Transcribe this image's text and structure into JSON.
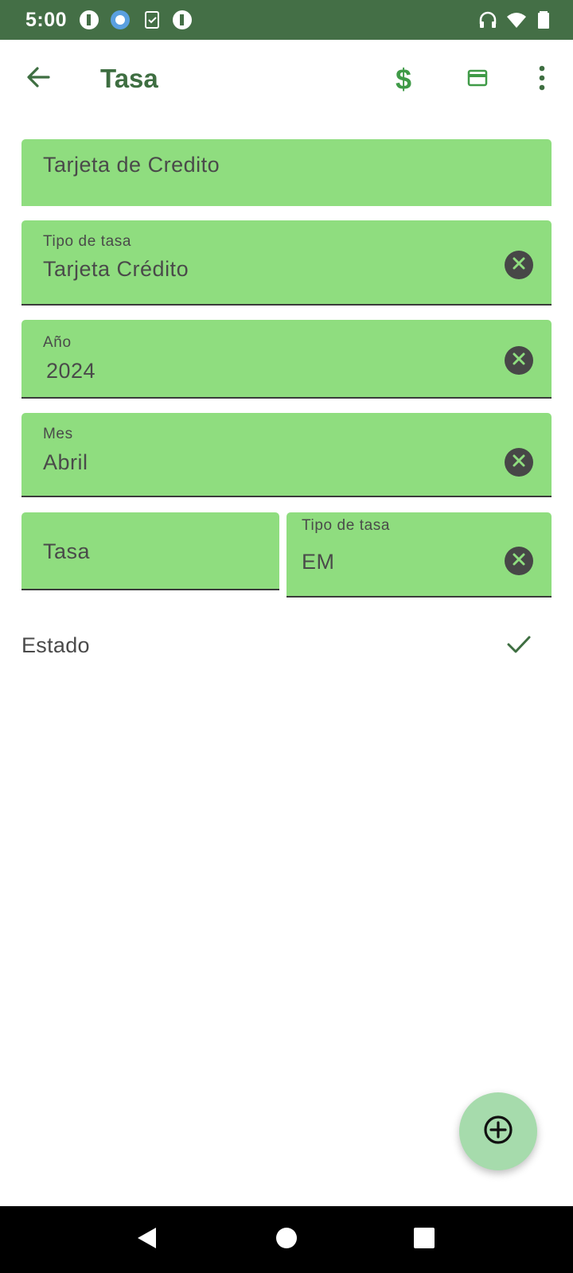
{
  "status_bar": {
    "time": "5:00",
    "left_icons": [
      "notification-app-icon",
      "notification-globe-icon",
      "notification-clipboard-icon",
      "notification-app-icon"
    ],
    "right_icons": [
      "headphones-icon",
      "wifi-icon",
      "battery-icon"
    ]
  },
  "app_bar": {
    "title": "Tasa",
    "back_icon": "arrow-left-icon",
    "actions": [
      "dollar-icon",
      "credit-card-icon",
      "more-vert-icon"
    ]
  },
  "form": {
    "product_name": "Tarjeta de Credito",
    "tipo_tasa": {
      "label": "Tipo de tasa",
      "value": "Tarjeta Crédito"
    },
    "anio": {
      "label": "Año",
      "value": "2024"
    },
    "mes": {
      "label": "Mes",
      "value": "Abril"
    },
    "tasa": {
      "placeholder": "Tasa"
    },
    "tipo_tasa_2": {
      "label": "Tipo de tasa",
      "value": "EM"
    },
    "estado": {
      "label": "Estado",
      "checked": true
    }
  },
  "fab": {
    "icon": "add-circle-icon"
  },
  "nav": {
    "icons": [
      "back-triangle-icon",
      "home-circle-icon",
      "recents-square-icon"
    ]
  },
  "colors": {
    "status_bar": "#446f46",
    "accent": "#3e6e41",
    "field_bg": "#8fdd7f",
    "fab_bg": "#a6dbac"
  }
}
